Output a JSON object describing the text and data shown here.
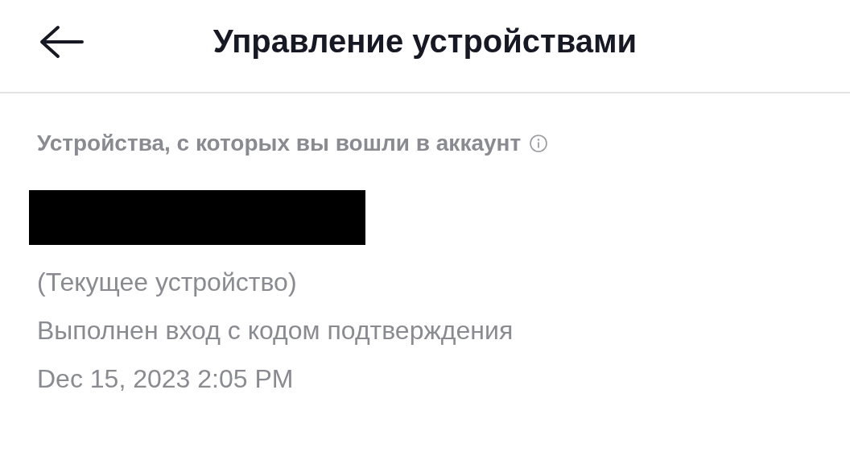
{
  "header": {
    "title": "Управление устройствами"
  },
  "section": {
    "label": "Устройства, с которых вы вошли в аккаунт"
  },
  "devices": [
    {
      "name_redacted": true,
      "current": "(Текущее устройство)",
      "method": "Выполнен вход с кодом подтверждения",
      "date": "Dec 15, 2023 2:05 PM"
    }
  ]
}
